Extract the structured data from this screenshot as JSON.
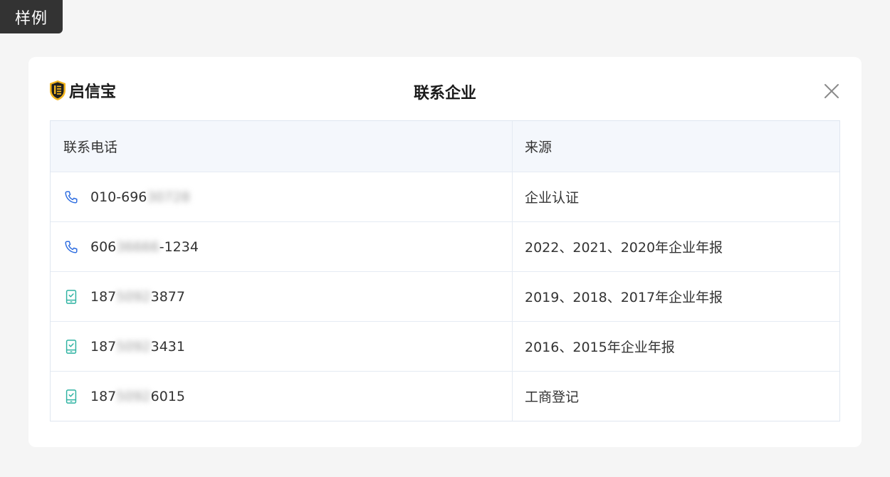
{
  "badge": {
    "label": "样例"
  },
  "dialog": {
    "brand_name": "启信宝",
    "title": "联系企业",
    "close_icon": "close-icon"
  },
  "table": {
    "headers": {
      "phone": "联系电话",
      "source": "来源"
    },
    "rows": [
      {
        "type": "landline",
        "icon": "phone-icon",
        "prefix": "010-696",
        "masked": "30728",
        "suffix": "",
        "source": "企业认证"
      },
      {
        "type": "landline",
        "icon": "phone-icon",
        "prefix": "606",
        "masked": "36666",
        "suffix": "-1234",
        "source": "2022、2021、2020年企业年报"
      },
      {
        "type": "mobile",
        "icon": "mobile-phone-icon",
        "prefix": "187",
        "masked": "5092",
        "suffix": "3877",
        "source": "2019、2018、2017年企业年报"
      },
      {
        "type": "mobile",
        "icon": "mobile-phone-icon",
        "prefix": "187",
        "masked": "5092",
        "suffix": "3431",
        "source": "2016、2015年企业年报"
      },
      {
        "type": "mobile",
        "icon": "mobile-phone-icon",
        "prefix": "187",
        "masked": "5092",
        "suffix": "6015",
        "source": "工商登记"
      }
    ]
  },
  "colors": {
    "brand_gold": "#f2b51e",
    "phone_icon_blue": "#2e6de0",
    "mobile_icon_teal": "#2fb3a2",
    "header_bg": "#f4f7fc"
  }
}
